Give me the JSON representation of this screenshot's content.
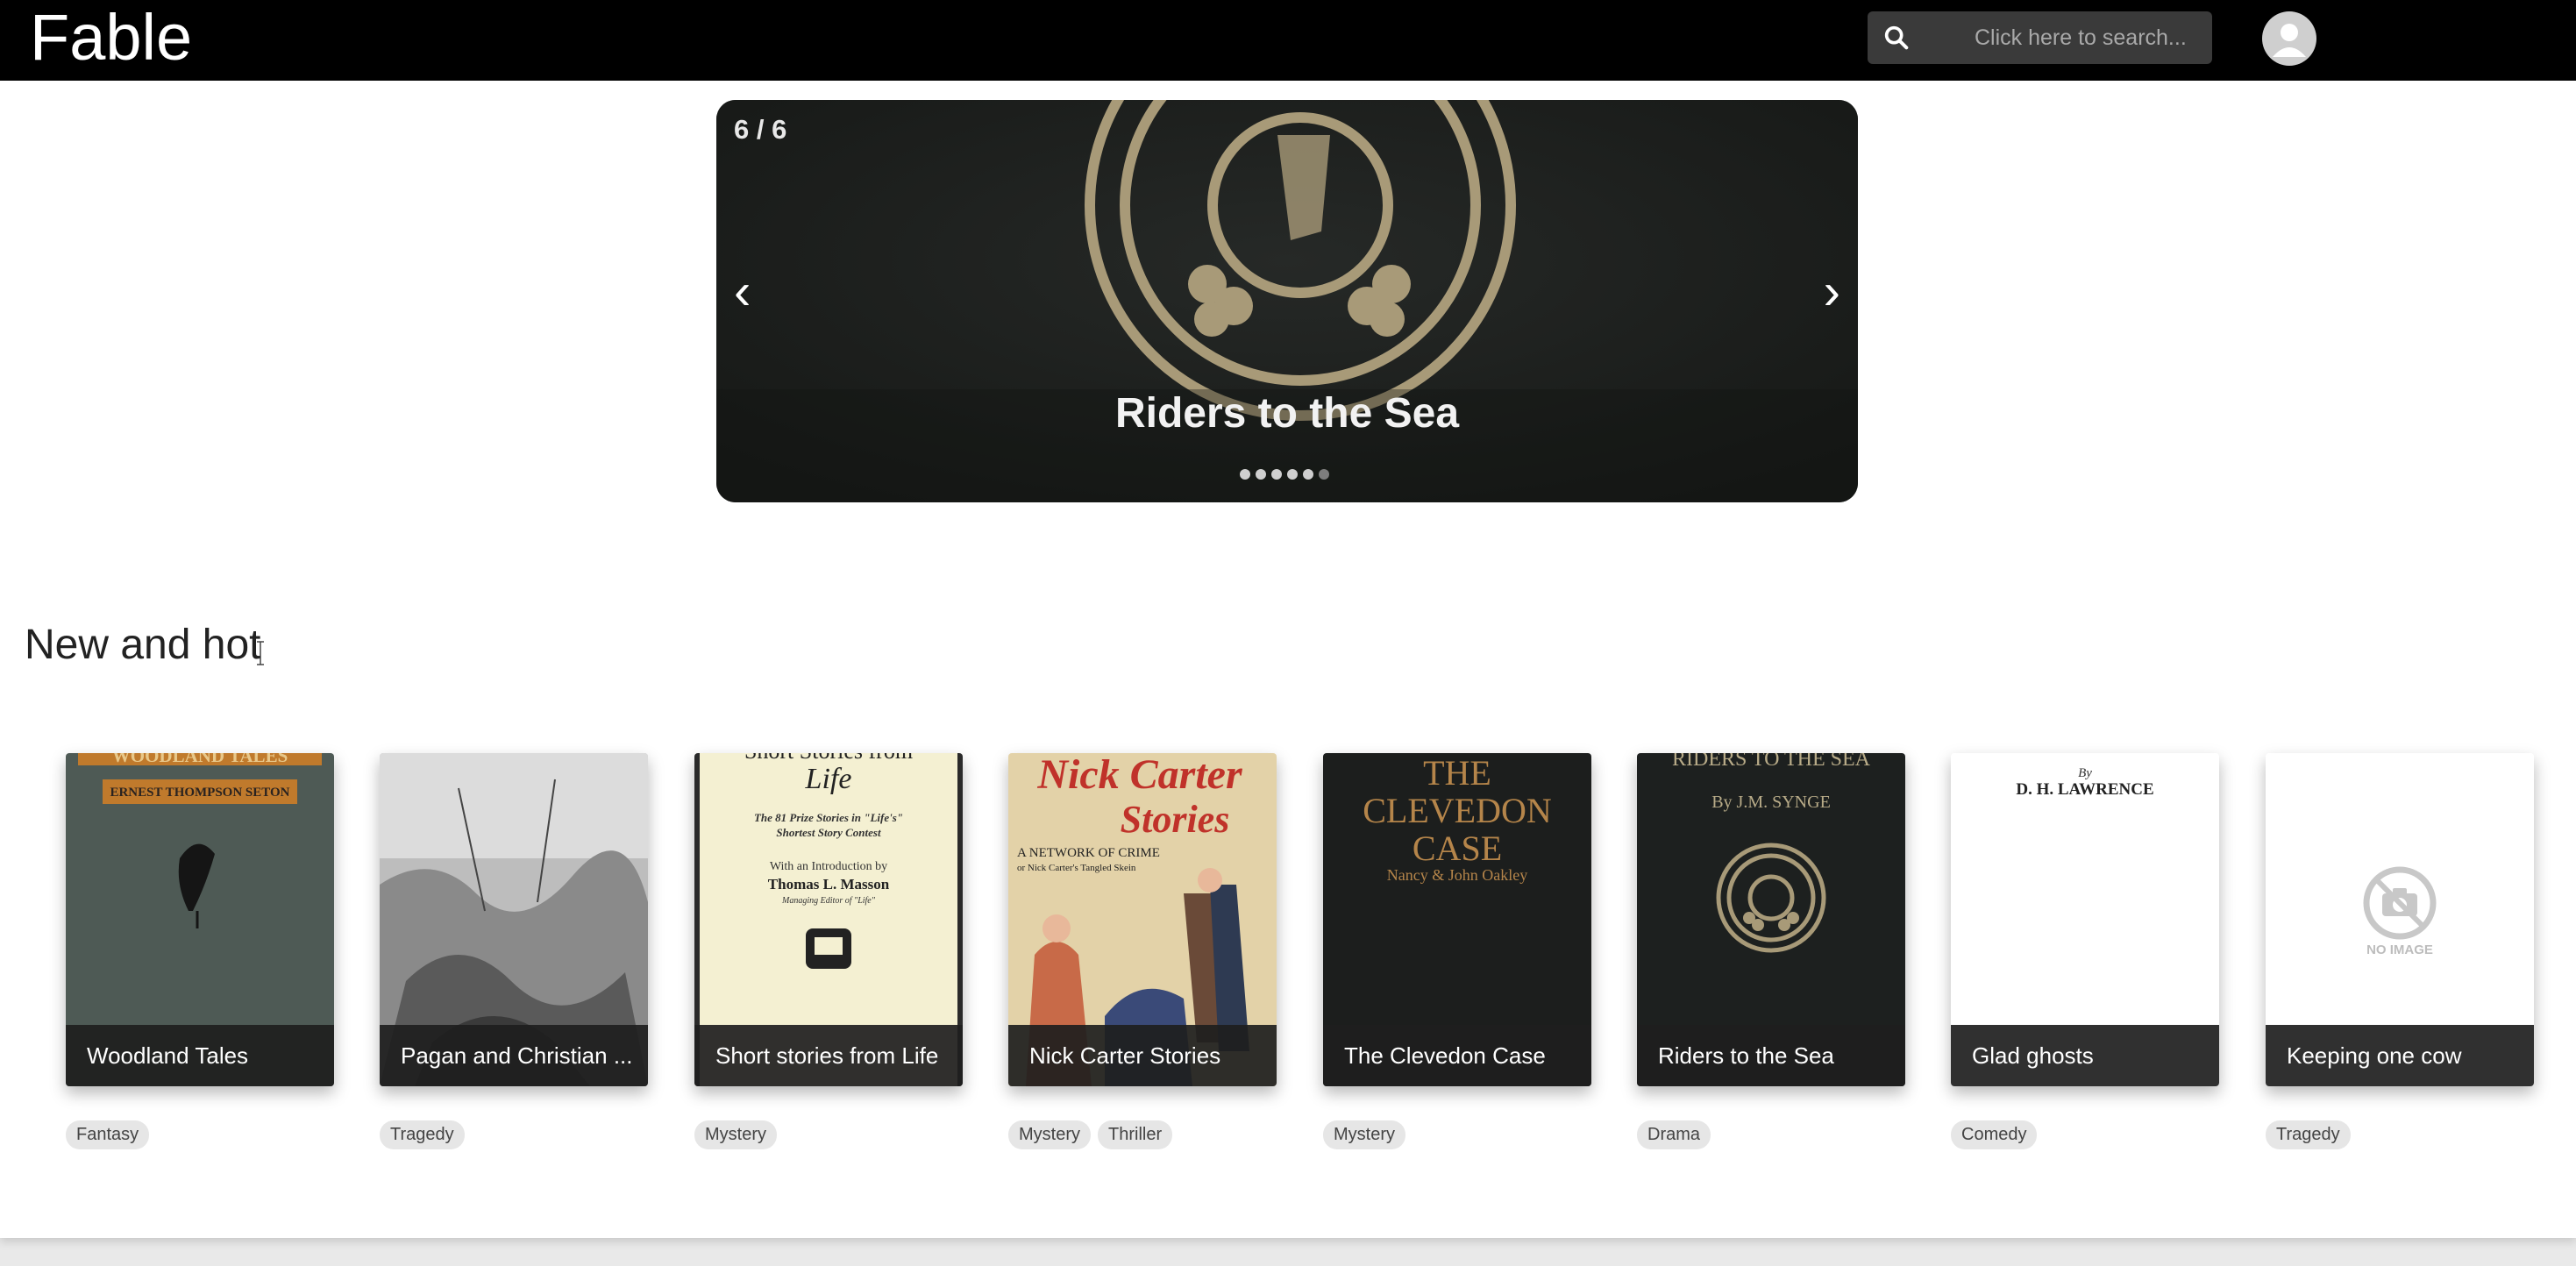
{
  "header": {
    "app_title": "Fable",
    "search_placeholder": "Click here to search..."
  },
  "carousel": {
    "counter": "6 / 6",
    "title": "Riders to the Sea",
    "prev": "‹",
    "next": "›",
    "slide_count": 6,
    "active_index": 5
  },
  "section": {
    "title": "New and hot"
  },
  "books": [
    {
      "title": "Woodland Tales",
      "tags": [
        "Fantasy"
      ],
      "cover_text": [
        "WOODLAND TALES",
        "ERNEST THOMPSON SETON"
      ]
    },
    {
      "title": "Pagan and Christian ...",
      "tags": [
        "Tragedy"
      ],
      "cover_text": []
    },
    {
      "title": "Short stories from Life",
      "tags": [
        "Mystery"
      ],
      "cover_text": [
        "Short Stories from",
        "Life",
        "The 81 Prize Stories in \"Life's\"",
        "Shortest Story Contest",
        "With an Introduction by",
        "Thomas L. Masson",
        "Managing Editor of \"Life\""
      ]
    },
    {
      "title": "Nick Carter Stories",
      "tags": [
        "Mystery",
        "Thriller"
      ],
      "cover_text": [
        "Nick Carter",
        "Stories",
        "A NETWORK OF CRIME",
        "or Nick Carter's Tangled Skein"
      ]
    },
    {
      "title": "The Clevedon Case",
      "tags": [
        "Mystery"
      ],
      "cover_text": [
        "THE",
        "CLEVEDON",
        "CASE",
        "Nancy & John Oakley"
      ]
    },
    {
      "title": "Riders to the Sea",
      "tags": [
        "Drama"
      ],
      "cover_text": [
        "RIDERS TO THE SEA",
        "By J.M. SYNGE"
      ]
    },
    {
      "title": "Glad ghosts",
      "tags": [
        "Comedy"
      ],
      "cover_text": [
        "By",
        "D. H. LAWRENCE"
      ]
    },
    {
      "title": "Keeping one cow",
      "tags": [
        "Tragedy"
      ],
      "cover_text": [
        "NO IMAGE"
      ]
    }
  ],
  "colors": {
    "header_bg": "#000000",
    "search_bg": "#3a3a3a",
    "caption_bg": "#1e1e1e",
    "tag_bg": "#e6e6e6"
  }
}
